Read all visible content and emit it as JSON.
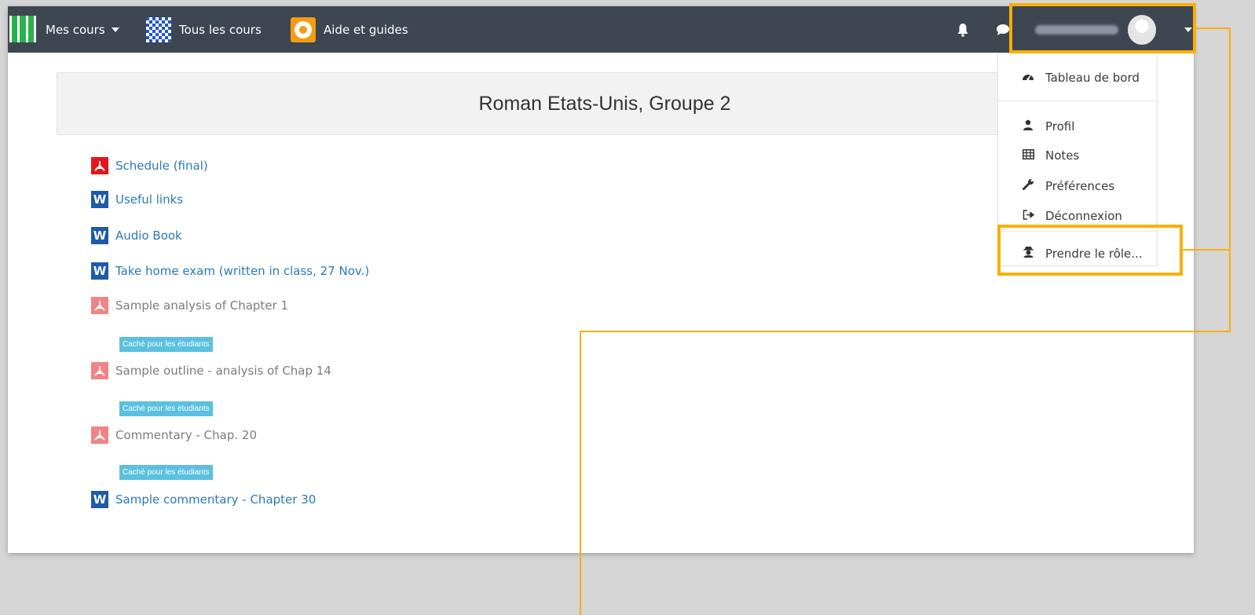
{
  "navbar": {
    "my_courses": "Mes cours",
    "all_courses": "Tous les cours",
    "help": "Aide et guides",
    "icons": [
      "bell-icon",
      "chat-icon",
      "user-avatar",
      "caret-down-icon"
    ]
  },
  "user_menu": {
    "items": [
      {
        "label": "Tableau de bord",
        "icon": "dashboard-icon"
      },
      {
        "label": "Profil",
        "icon": "user-icon"
      },
      {
        "label": "Notes",
        "icon": "table-icon"
      },
      {
        "label": "Préférences",
        "icon": "wrench-icon"
      },
      {
        "label": "Déconnexion",
        "icon": "logout-icon"
      },
      {
        "label": "Prendre le rôle...",
        "icon": "role-icon"
      }
    ]
  },
  "course": {
    "title": "Roman Etats-Unis, Groupe 2",
    "activities": [
      {
        "label": "Schedule (final)",
        "type": "pdf",
        "hidden": false
      },
      {
        "label": "Useful links",
        "type": "word",
        "hidden": false
      },
      {
        "label": "Audio Book",
        "type": "word",
        "hidden": false
      },
      {
        "label": "Take home exam (written in class, 27 Nov.)",
        "type": "word",
        "hidden": false
      },
      {
        "label": "Sample analysis of Chapter 1",
        "type": "pdf",
        "hidden": true
      },
      {
        "label": "Sample outline - analysis of Chap 14",
        "type": "pdf",
        "hidden": true
      },
      {
        "label": "Commentary - Chap. 20",
        "type": "pdf",
        "hidden": true
      },
      {
        "label": "Sample commentary - Chapter 30",
        "type": "word",
        "hidden": false
      }
    ],
    "hidden_badge": "Caché pour les étudiants"
  },
  "colors": {
    "navbar_bg": "#3d4651",
    "link": "#2c79b5",
    "highlight": "#f9b000",
    "badge": "#5bc0de"
  }
}
